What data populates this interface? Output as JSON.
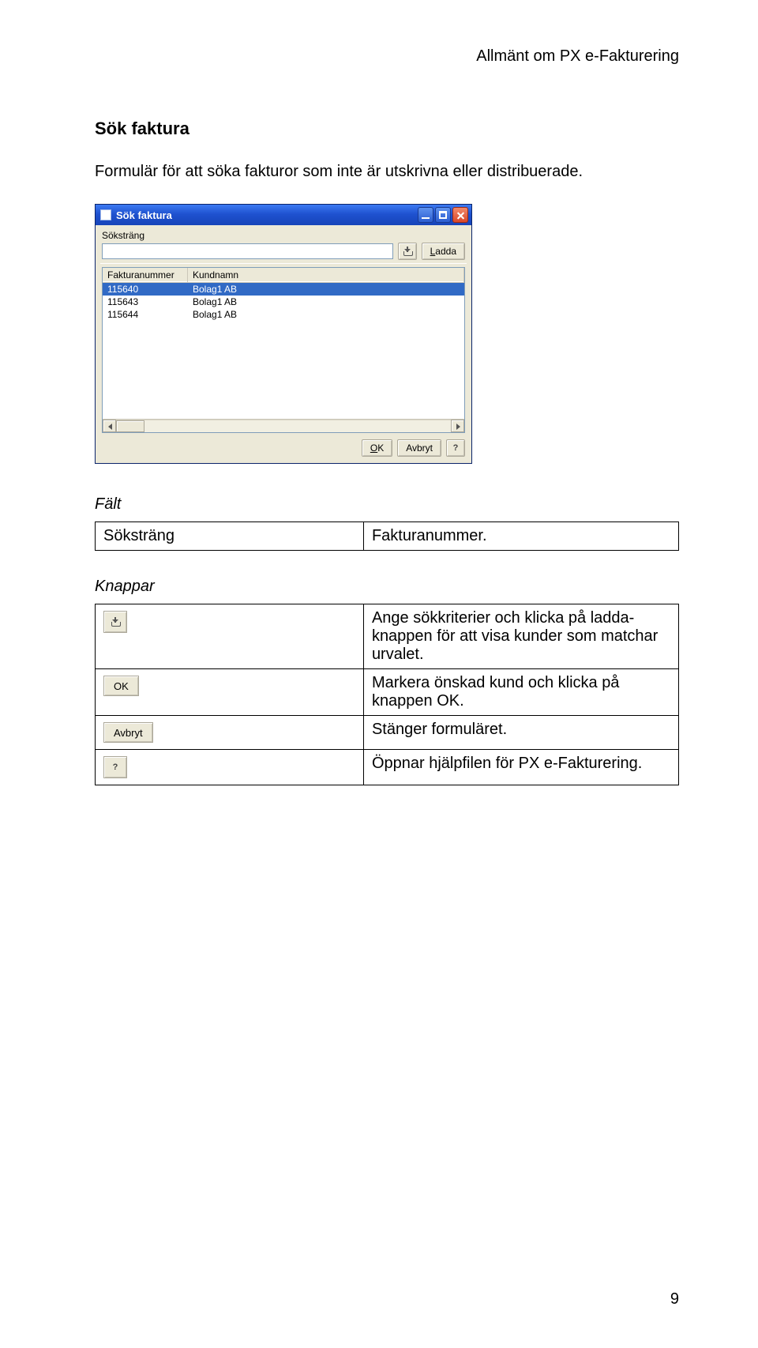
{
  "header": {
    "text": "Allmänt om PX e-Fakturering"
  },
  "section_title": "Sök faktura",
  "intro": "Formulär för att söka fakturor som inte är utskrivna eller distribuerade.",
  "dialog": {
    "title": "Sök faktura",
    "label_sokstrang": "Söksträng",
    "btn_ladda": "Ladda",
    "columns": {
      "a": "Fakturanummer",
      "b": "Kundnamn"
    },
    "rows": [
      {
        "a": "115640",
        "b": "Bolag1 AB",
        "selected": true
      },
      {
        "a": "115643",
        "b": "Bolag1 AB",
        "selected": false
      },
      {
        "a": "115644",
        "b": "Bolag1 AB",
        "selected": false
      }
    ],
    "btn_ok": "OK",
    "btn_avbryt": "Avbryt",
    "help_glyph": "?"
  },
  "falt": {
    "heading": "Fält",
    "rows": [
      {
        "left": "Söksträng",
        "right": "Fakturanummer."
      }
    ]
  },
  "knappar": {
    "heading": "Knappar",
    "rows": [
      {
        "btn": "load",
        "right": "Ange sökkriterier och klicka på ladda-knappen för att visa kunder som matchar urvalet."
      },
      {
        "btn": "ok",
        "label": "OK",
        "right": "Markera önskad kund och klicka på knappen OK."
      },
      {
        "btn": "avbryt",
        "label": "Avbryt",
        "right": "Stänger formuläret."
      },
      {
        "btn": "help",
        "label": "?",
        "right": "Öppnar hjälpfilen för PX e-Fakturering."
      }
    ]
  },
  "pagenum": "9"
}
